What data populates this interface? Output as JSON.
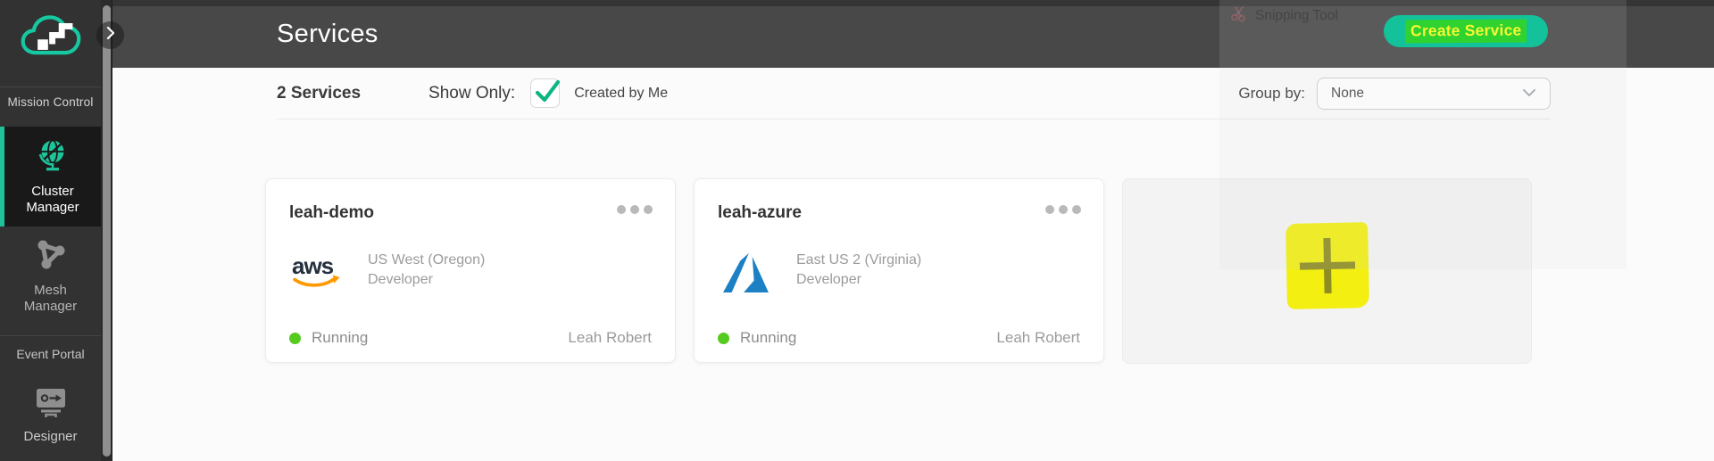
{
  "sidebar": {
    "mission_control": "Mission Control",
    "cluster_manager": "Cluster Manager",
    "mesh_manager": "Mesh Manager",
    "event_portal": "Event Portal",
    "designer": "Designer"
  },
  "header": {
    "title": "Services",
    "create_button": "Create Service"
  },
  "toolbar": {
    "services_count": "2 Services",
    "show_only": "Show Only:",
    "checkbox_checked": true,
    "created_by_me": "Created by Me",
    "group_by": "Group by:",
    "group_by_value": "None"
  },
  "cards": [
    {
      "name": "leah-demo",
      "provider": "aws",
      "region": "US West (Oregon)",
      "plan": "Developer",
      "status": "Running",
      "owner": "Leah Robert"
    },
    {
      "name": "leah-azure",
      "provider": "azure",
      "region": "East US 2 (Virginia)",
      "plan": "Developer",
      "status": "Running",
      "owner": "Leah Robert"
    }
  ],
  "add_card": {
    "icon": "plus"
  },
  "ghost_window": {
    "title": "Snipping Tool"
  },
  "colors": {
    "accent_teal": "#13c29b",
    "active_nav_teal": "#1fc39a",
    "annotation_green": "#2fd22f",
    "annotation_yellow_text": "#f8f833",
    "annotation_yellow_marker": "#f2ef11",
    "status_running_green": "#55ca1f",
    "aws_orange": "#ff9900",
    "aws_navy": "#252f3e",
    "azure_blue": "#1b80c4",
    "header_gray": "#484848",
    "sidebar_gray": "#323232"
  }
}
